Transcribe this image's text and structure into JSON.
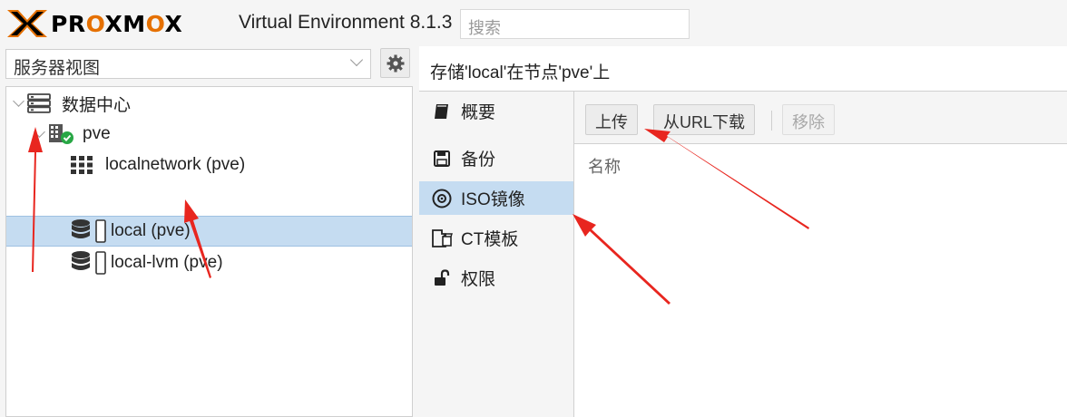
{
  "header": {
    "logo_x": "X",
    "logo_text": "PROXMOX",
    "product_version": "Virtual Environment 8.1.3",
    "search_placeholder": "搜索"
  },
  "left_panel": {
    "view_select_value": "服务器视图",
    "tree": [
      {
        "label": "数据中心",
        "icon": "datacenter-icon",
        "level": 0
      },
      {
        "label": "pve",
        "icon": "node-online-icon",
        "level": 1
      },
      {
        "label": "localnetwork (pve)",
        "icon": "network-grid-icon",
        "level": 2
      },
      {
        "label": "local (pve)",
        "icon": "storage-icon",
        "level": 2,
        "selected": true
      },
      {
        "label": "local-lvm (pve)",
        "icon": "storage-icon",
        "level": 2
      }
    ]
  },
  "right_panel": {
    "title": "存储'local'在节点'pve'上",
    "nav": [
      {
        "label": "概要",
        "icon": "book-icon"
      },
      {
        "label": "备份",
        "icon": "floppy-icon"
      },
      {
        "label": "ISO镜像",
        "icon": "disc-icon",
        "active": true
      },
      {
        "label": "CT模板",
        "icon": "template-icon"
      },
      {
        "label": "权限",
        "icon": "unlock-icon"
      }
    ],
    "toolbar": {
      "upload": "上传",
      "download_url": "从URL下载",
      "remove": "移除"
    },
    "grid_column": "名称"
  },
  "colors": {
    "accent_orange": "#e57000",
    "selection_blue": "#c5dcf1",
    "annotation_red": "#e8261f",
    "status_green": "#28a745"
  }
}
